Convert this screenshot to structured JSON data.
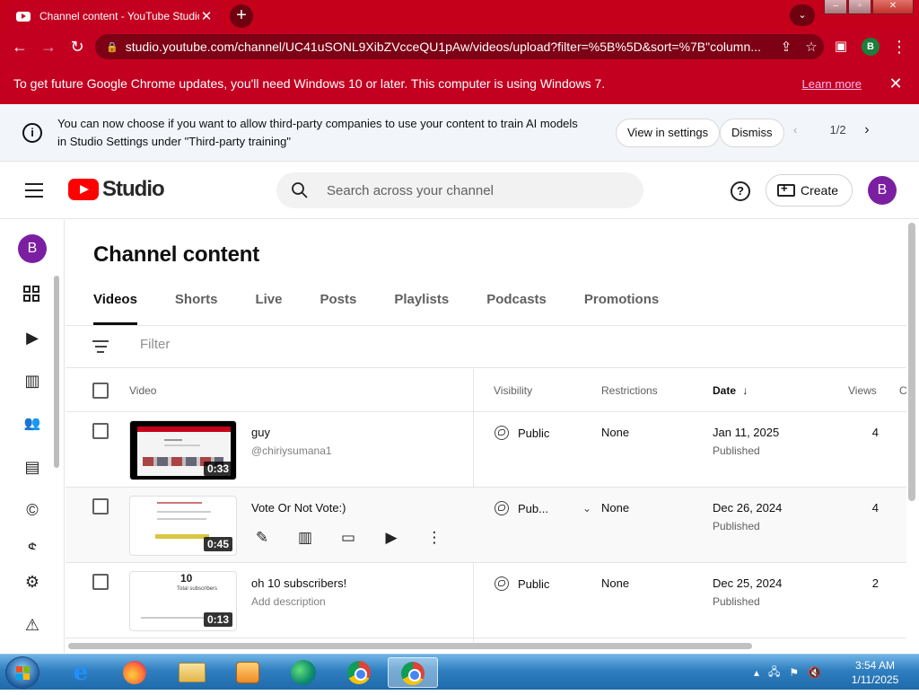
{
  "browser": {
    "tab_title": "Channel content - YouTube Studio",
    "new_tab_icon": "plus-icon",
    "url": "studio.youtube.com/channel/UC41uSONL9XibZVcceQU1pAw/videos/upload?filter=%5B%5D&sort=%7B\"column...",
    "profile_initial": "B",
    "infobar_message": "To get future Google Chrome updates, you'll need Windows 10 or later. This computer is using Windows 7.",
    "infobar_link": "Learn more",
    "accent_color": "#c4001b"
  },
  "notice": {
    "line1": "You can now choose if you want to allow third-party companies to use your content to train AI models",
    "line2": "in Studio Settings under \"Third-party training\"",
    "view_settings": "View in settings",
    "dismiss": "Dismiss",
    "pager": "1/2"
  },
  "header": {
    "brand": "Studio",
    "search_placeholder": "Search across your channel",
    "create_label": "Create",
    "avatar_initial": "B"
  },
  "rail": {
    "avatar_initial": "B",
    "icons": [
      "dashboard-icon",
      "content-icon",
      "analytics-icon",
      "community-icon",
      "subtitles-icon",
      "copyright-icon",
      "earn-icon",
      "settings-icon",
      "feedback-icon"
    ]
  },
  "main": {
    "title": "Channel content",
    "tabs": [
      "Videos",
      "Shorts",
      "Live",
      "Posts",
      "Playlists",
      "Podcasts",
      "Promotions"
    ],
    "active_tab": "Videos",
    "filter_placeholder": "Filter",
    "columns": {
      "video": "Video",
      "visibility": "Visibility",
      "restrictions": "Restrictions",
      "date": "Date",
      "views": "Views",
      "comments": "C"
    },
    "rows": [
      {
        "title": "guy",
        "subtitle": "@chiriysumana1",
        "duration": "0:33",
        "visibility": "Public",
        "restrictions": "None",
        "date": "Jan 11, 2025",
        "status": "Published",
        "views": "4"
      },
      {
        "title": "Vote Or Not Vote:)",
        "subtitle": "",
        "duration": "0:45",
        "visibility": "Pub...",
        "restrictions": "None",
        "date": "Dec 26, 2024",
        "status": "Published",
        "views": "4"
      },
      {
        "title": "oh 10 subscribers!",
        "subtitle": "Add description",
        "duration": "0:13",
        "thumb_number": "10",
        "thumb_caption": "Total subscribers",
        "visibility": "Public",
        "restrictions": "None",
        "date": "Dec 25, 2024",
        "status": "Published",
        "views": "2"
      }
    ]
  },
  "taskbar": {
    "apps": [
      "internet-explorer-icon",
      "firefox-icon",
      "file-explorer-icon",
      "media-player-icon",
      "edge-icon",
      "chrome-icon",
      "chrome-profile-icon"
    ],
    "time": "3:54 AM",
    "date": "1/11/2025"
  }
}
